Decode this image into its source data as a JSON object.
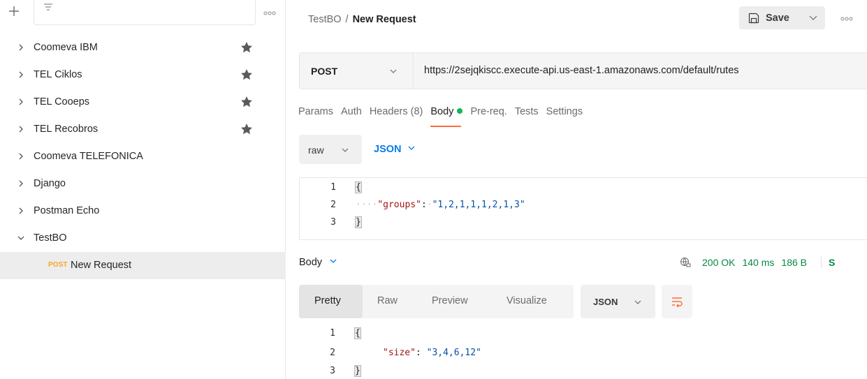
{
  "sidebar": {
    "add_icon": "plus-icon",
    "filter_icon": "filter-icon",
    "more_icon": "more-dots-icon",
    "collections": [
      {
        "label": "Coomeva IBM",
        "starred": true,
        "expanded": false
      },
      {
        "label": "TEL Ciklos",
        "starred": true,
        "expanded": false
      },
      {
        "label": "TEL Cooeps",
        "starred": true,
        "expanded": false
      },
      {
        "label": "TEL Recobros",
        "starred": true,
        "expanded": false
      },
      {
        "label": "Coomeva TELEFONICA",
        "starred": false,
        "expanded": false
      },
      {
        "label": "Django",
        "starred": false,
        "expanded": false
      },
      {
        "label": "Postman Echo",
        "starred": false,
        "expanded": false
      },
      {
        "label": "TestBO",
        "starred": false,
        "expanded": true
      }
    ],
    "request_item": {
      "method": "POST",
      "label": "New Request"
    }
  },
  "header": {
    "breadcrumb_parent": "TestBO",
    "breadcrumb_sep": "/",
    "breadcrumb_current": "New Request",
    "save_label": "Save"
  },
  "request": {
    "method": "POST",
    "url": "https://2sejqkiscc.execute-api.us-east-1.amazonaws.com/default/rutes",
    "tabs": [
      "Params",
      "Auth",
      "Headers (8)",
      "Body",
      "Pre-req.",
      "Tests",
      "Settings"
    ],
    "active_tab": "Body",
    "body_mode": "raw",
    "body_language": "JSON",
    "body_lines": [
      {
        "num": "1",
        "text": "{"
      },
      {
        "num": "2",
        "key": "\"groups\"",
        "value": "\"1,2,1,1,1,2,1,3\""
      },
      {
        "num": "3",
        "text": "}"
      }
    ]
  },
  "response": {
    "section_label": "Body",
    "status": "200 OK",
    "time": "140 ms",
    "size": "186 B",
    "cut_char": "S",
    "view_tabs": [
      "Pretty",
      "Raw",
      "Preview",
      "Visualize"
    ],
    "active_view": "Pretty",
    "language": "JSON",
    "body_lines": [
      {
        "num": "1",
        "text": "{"
      },
      {
        "num": "2",
        "key": "\"size\"",
        "value": "\"3,4,6,12\""
      },
      {
        "num": "3",
        "text": "}"
      }
    ]
  },
  "colors": {
    "accent": "#ff6c37",
    "method_post": "#f5a623",
    "status_ok": "#0a8745",
    "link_blue": "#097bed",
    "body_dot": "#0cbb52"
  }
}
